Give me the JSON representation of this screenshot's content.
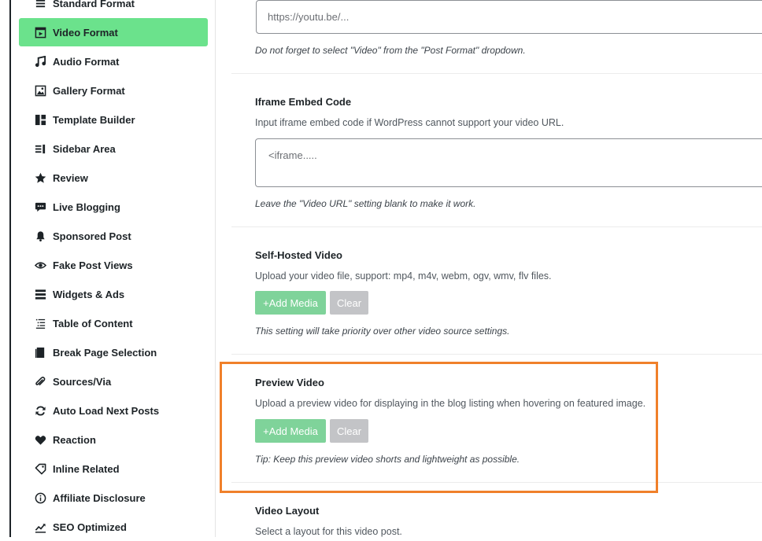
{
  "sidebar": {
    "items": [
      {
        "label": "Standard Format",
        "icon": "list-icon",
        "active": false
      },
      {
        "label": "Video Format",
        "icon": "video-icon",
        "active": true
      },
      {
        "label": "Audio Format",
        "icon": "music-icon",
        "active": false
      },
      {
        "label": "Gallery Format",
        "icon": "gallery-icon",
        "active": false
      },
      {
        "label": "Template Builder",
        "icon": "template-icon",
        "active": false
      },
      {
        "label": "Sidebar Area",
        "icon": "sidebar-icon",
        "active": false
      },
      {
        "label": "Review",
        "icon": "star-icon",
        "active": false
      },
      {
        "label": "Live Blogging",
        "icon": "chat-icon",
        "active": false
      },
      {
        "label": "Sponsored Post",
        "icon": "bell-icon",
        "active": false
      },
      {
        "label": "Fake Post Views",
        "icon": "eye-icon",
        "active": false
      },
      {
        "label": "Widgets & Ads",
        "icon": "widgets-icon",
        "active": false
      },
      {
        "label": "Table of Content",
        "icon": "toc-icon",
        "active": false
      },
      {
        "label": "Break Page Selection",
        "icon": "pages-icon",
        "active": false
      },
      {
        "label": "Sources/Via",
        "icon": "link-icon",
        "active": false
      },
      {
        "label": "Auto Load Next Posts",
        "icon": "refresh-icon",
        "active": false
      },
      {
        "label": "Reaction",
        "icon": "heart-icon",
        "active": false
      },
      {
        "label": "Inline Related",
        "icon": "tag-icon",
        "active": false
      },
      {
        "label": "Affiliate Disclosure",
        "icon": "info-icon",
        "active": false
      },
      {
        "label": "SEO Optimized",
        "icon": "seo-chart-icon",
        "active": false
      }
    ]
  },
  "main": {
    "video_url": {
      "placeholder": "https://youtu.be/...",
      "note": "Do not forget to select \"Video\" from the \"Post Format\" dropdown."
    },
    "iframe": {
      "title": "Iframe Embed Code",
      "desc": "Input iframe embed code if WordPress cannot support your video URL.",
      "placeholder": "<iframe.....",
      "note": "Leave the \"Video URL\" setting blank to make it work."
    },
    "self_hosted": {
      "title": "Self-Hosted Video",
      "desc": "Upload your video file, support: mp4, m4v, webm, ogv, wmv, flv files.",
      "add_label": "+Add Media",
      "clear_label": "Clear",
      "note": "This setting will take priority over other video source settings."
    },
    "preview": {
      "title": "Preview Video",
      "desc": "Upload a preview video for displaying in the blog listing when hovering on featured image.",
      "add_label": "+Add Media",
      "clear_label": "Clear",
      "note": "Tip: Keep this preview video shorts and lightweight as possible."
    },
    "layout": {
      "title": "Video Layout",
      "desc": "Select a layout for this video post."
    }
  },
  "colors": {
    "active_nav": "#6be28c",
    "add_button": "#7fd39a",
    "clear_button": "#c3c4c7",
    "highlight": "#f0802a"
  }
}
